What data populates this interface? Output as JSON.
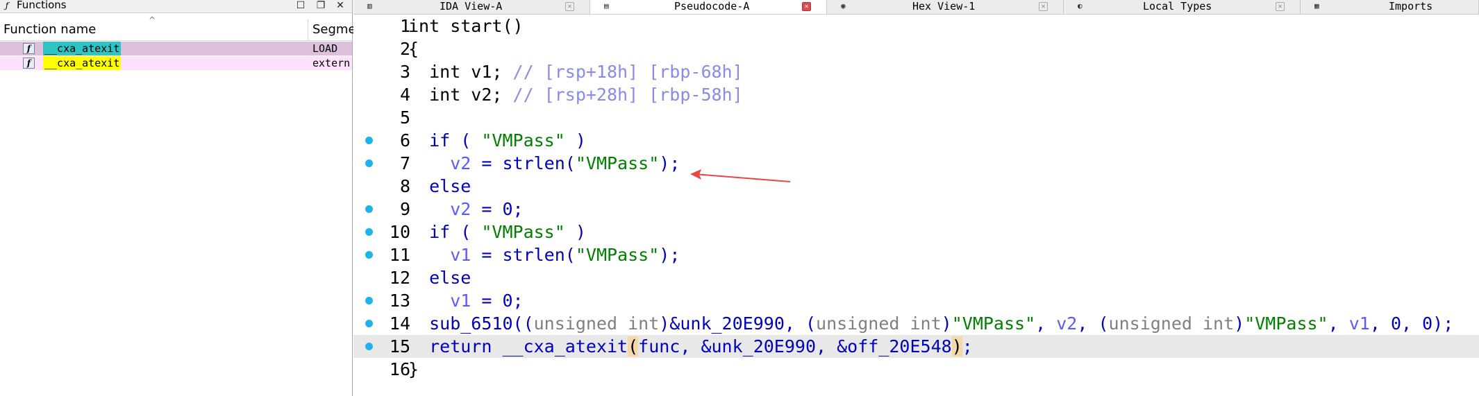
{
  "functions_window": {
    "title": "Functions",
    "title_icon": "function-icon",
    "column_name": "Function name",
    "column_segment": "Segme",
    "rows": [
      {
        "icon_label": "f",
        "name": "__cxa_atexit",
        "segment": "LOAD",
        "highlight": "#2ec4c4",
        "row_bg": "#dcc0dc"
      },
      {
        "icon_label": "f",
        "name": "__cxa_atexit",
        "segment": "extern",
        "highlight": "#ffff00",
        "row_bg": "#ffe0ff"
      }
    ]
  },
  "tabs": [
    {
      "label": "IDA View-A",
      "icon": "flowchart-icon"
    },
    {
      "label": "Pseudocode-A",
      "icon": "document-icon",
      "active": true
    },
    {
      "label": "Hex View-1",
      "icon": "hex-icon"
    },
    {
      "label": "Local Types",
      "icon": "types-icon"
    },
    {
      "label": "Imports",
      "icon": "imports-icon"
    }
  ],
  "code": {
    "current_line": 15,
    "breakpoint_lines": [
      6,
      7,
      9,
      10,
      11,
      13,
      14,
      15
    ],
    "lines": [
      {
        "n": "1",
        "tokens": [
          {
            "t": "int start()",
            "c": "plain"
          }
        ]
      },
      {
        "n": "2",
        "tokens": [
          {
            "t": "{",
            "c": "plain"
          }
        ]
      },
      {
        "n": "3",
        "tokens": [
          {
            "t": "  int v1; ",
            "c": "plain"
          },
          {
            "t": "// [rsp+18h] [rbp-68h]",
            "c": "com"
          }
        ]
      },
      {
        "n": "4",
        "tokens": [
          {
            "t": "  int v2; ",
            "c": "plain"
          },
          {
            "t": "// [rsp+28h] [rbp-58h]",
            "c": "com"
          }
        ]
      },
      {
        "n": "5",
        "tokens": []
      },
      {
        "n": "6",
        "tokens": [
          {
            "t": "  if ( ",
            "c": "fn"
          },
          {
            "t": "\"VMPass\"",
            "c": "str"
          },
          {
            "t": " )",
            "c": "fn"
          }
        ]
      },
      {
        "n": "7",
        "tokens": [
          {
            "t": "    ",
            "c": "plain"
          },
          {
            "t": "v2",
            "c": "var"
          },
          {
            "t": " = strlen(",
            "c": "fn"
          },
          {
            "t": "\"VMPass\"",
            "c": "str"
          },
          {
            "t": ");",
            "c": "fn"
          }
        ]
      },
      {
        "n": "8",
        "tokens": [
          {
            "t": "  else",
            "c": "fn"
          }
        ]
      },
      {
        "n": "9",
        "tokens": [
          {
            "t": "    ",
            "c": "plain"
          },
          {
            "t": "v2",
            "c": "var"
          },
          {
            "t": " = 0;",
            "c": "fn"
          }
        ]
      },
      {
        "n": "10",
        "tokens": [
          {
            "t": "  if ( ",
            "c": "fn"
          },
          {
            "t": "\"VMPass\"",
            "c": "str"
          },
          {
            "t": " )",
            "c": "fn"
          }
        ]
      },
      {
        "n": "11",
        "tokens": [
          {
            "t": "    ",
            "c": "plain"
          },
          {
            "t": "v1",
            "c": "var"
          },
          {
            "t": " = strlen(",
            "c": "fn"
          },
          {
            "t": "\"VMPass\"",
            "c": "str"
          },
          {
            "t": ");",
            "c": "fn"
          }
        ]
      },
      {
        "n": "12",
        "tokens": [
          {
            "t": "  else",
            "c": "fn"
          }
        ]
      },
      {
        "n": "13",
        "tokens": [
          {
            "t": "    ",
            "c": "plain"
          },
          {
            "t": "v1",
            "c": "var"
          },
          {
            "t": " = 0;",
            "c": "fn"
          }
        ]
      },
      {
        "n": "14",
        "tokens": [
          {
            "t": "  sub_6510((",
            "c": "fn"
          },
          {
            "t": "unsigned int",
            "c": "gray"
          },
          {
            "t": ")&unk_20E990, (",
            "c": "fn"
          },
          {
            "t": "unsigned int",
            "c": "gray"
          },
          {
            "t": ")",
            "c": "fn"
          },
          {
            "t": "\"VMPass\"",
            "c": "str"
          },
          {
            "t": ", ",
            "c": "fn"
          },
          {
            "t": "v2",
            "c": "var"
          },
          {
            "t": ", (",
            "c": "fn"
          },
          {
            "t": "unsigned int",
            "c": "gray"
          },
          {
            "t": ")",
            "c": "fn"
          },
          {
            "t": "\"VMPass\"",
            "c": "str"
          },
          {
            "t": ", ",
            "c": "fn"
          },
          {
            "t": "v1",
            "c": "var"
          },
          {
            "t": ", 0, 0);",
            "c": "fn"
          }
        ]
      },
      {
        "n": "15",
        "tokens": [
          {
            "t": "  return __cxa_atexit",
            "c": "fn"
          },
          {
            "t": "(",
            "c": "brace"
          },
          {
            "t": "func, &unk_20E990, &off_20E548",
            "c": "fn"
          },
          {
            "t": ")",
            "c": "brace"
          },
          {
            "t": ";",
            "c": "fn"
          }
        ]
      },
      {
        "n": "16",
        "tokens": [
          {
            "t": "}",
            "c": "plain"
          }
        ]
      }
    ]
  },
  "annotation": {
    "type": "red-arrow",
    "color": "#ee4444"
  }
}
